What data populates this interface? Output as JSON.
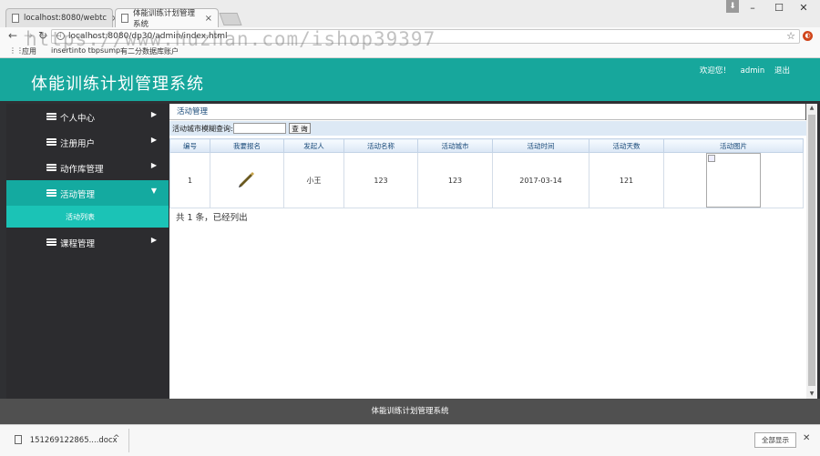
{
  "browser": {
    "tabs": [
      {
        "title": "localhost:8080/webtc"
      },
      {
        "title": "体能训练计划管理系统"
      }
    ],
    "url": "localhost:8080/dp30/admin/index.html",
    "bookmarks": [
      "应用",
      "insertinto tbpsump",
      "有二分数据库账户"
    ],
    "watermark": "https://www.huzhan.com/ishop39397"
  },
  "header": {
    "title": "体能训练计划管理系统",
    "welcome": "欢迎您！",
    "username": "admin",
    "logout": "退出"
  },
  "sidebar": {
    "items": [
      {
        "label": "个人中心",
        "arrow": "▶"
      },
      {
        "label": "注册用户",
        "arrow": "▶"
      },
      {
        "label": "动作库管理",
        "arrow": "▶"
      },
      {
        "label": "活动管理",
        "arrow": "▼"
      },
      {
        "label": "课程管理",
        "arrow": "▶"
      }
    ],
    "subitem": {
      "label": "活动列表"
    }
  },
  "main": {
    "section_title": "活动管理",
    "search": {
      "label": "活动城市模糊查询:",
      "value": "",
      "button": "查 询"
    },
    "table": {
      "headers": [
        "编号",
        "我要报名",
        "发起人",
        "活动名称",
        "活动城市",
        "活动时间",
        "活动天数",
        "活动图片"
      ],
      "rows": [
        {
          "id": "1",
          "signup": "",
          "initiator": "小王",
          "name": "123",
          "city": "123",
          "time": "2017-03-14",
          "days": "121",
          "image": ""
        }
      ]
    },
    "count": "共 1 条，已经列出"
  },
  "footer": {
    "text": "体能训练计划管理系统"
  },
  "downloads": {
    "file": "151269122865....docx",
    "show_all": "全部显示"
  },
  "colors": {
    "brand": "#17a79c",
    "sidebar": "#2c2c2f",
    "active": "#14aaa0",
    "footer": "#505050"
  }
}
